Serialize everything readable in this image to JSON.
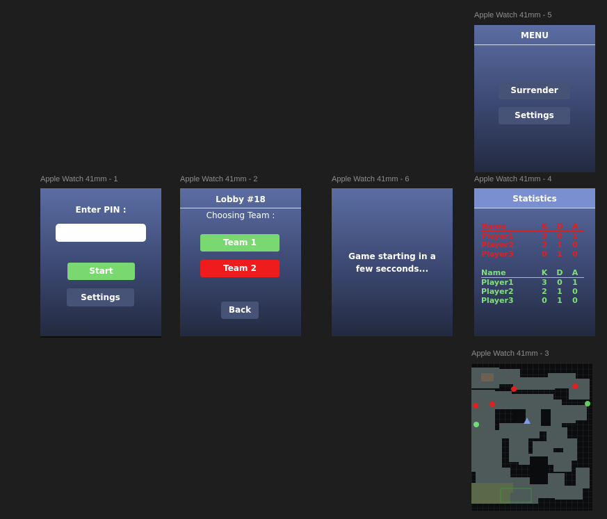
{
  "frames": {
    "f5": {
      "label": "Apple Watch 41mm - 5",
      "title": "MENU",
      "buttons": [
        "Surrender",
        "Settings"
      ]
    },
    "f1": {
      "label": "Apple Watch 41mm - 1",
      "prompt": "Enter PIN :",
      "pin_value": "",
      "start": "Start",
      "settings": "Settings"
    },
    "f2": {
      "label": "Apple Watch 41mm - 2",
      "title": "Lobby #18",
      "subtitle": "Choosing Team :",
      "team1": "Team 1",
      "team2": "Team 2",
      "back": "Back"
    },
    "f6": {
      "label": "Apple Watch 41mm - 6",
      "message": "Game starting in a few secconds..."
    },
    "f4": {
      "label": "Apple Watch 41mm - 4",
      "title": "Statistics",
      "columns": [
        "Name",
        "K",
        "D",
        "A"
      ],
      "red_team": [
        [
          "Player1",
          "3",
          "0",
          "1"
        ],
        [
          "Player2",
          "2",
          "1",
          "0"
        ],
        [
          "Player3",
          "0",
          "1",
          "0"
        ]
      ],
      "green_team": [
        [
          "Player1",
          "3",
          "0",
          "1"
        ],
        [
          "Player2",
          "2",
          "1",
          "0"
        ],
        [
          "Player3",
          "0",
          "1",
          "0"
        ]
      ]
    },
    "f3": {
      "label": "Apple Watch 41mm - 3"
    }
  },
  "colors": {
    "team_green": "#79d86f",
    "team_red": "#ee1c1c",
    "button_dark": "#465276"
  }
}
